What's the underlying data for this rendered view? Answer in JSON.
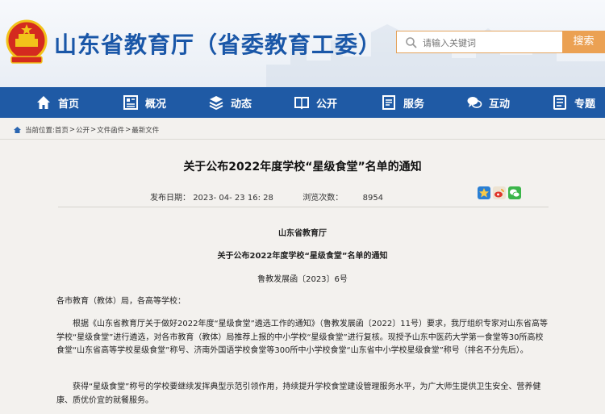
{
  "header": {
    "site_title": "山东省教育厅（省委教育工委）",
    "search_placeholder": "请输入关键词",
    "search_button": "搜索"
  },
  "nav": [
    {
      "label": "首页",
      "icon": "home-icon"
    },
    {
      "label": "概况",
      "icon": "overview-icon"
    },
    {
      "label": "动态",
      "icon": "news-icon"
    },
    {
      "label": "公开",
      "icon": "book-icon"
    },
    {
      "label": "服务",
      "icon": "service-icon"
    },
    {
      "label": "互动",
      "icon": "chat-icon"
    },
    {
      "label": "专题",
      "icon": "topic-icon"
    }
  ],
  "breadcrumb": {
    "prefix": "当前位置:",
    "items": [
      "首页",
      "公开",
      "文件函件",
      "最新文件"
    ],
    "separator": ">"
  },
  "article": {
    "title": "关于公布2022年度学校“星级食堂”名单的通知",
    "publish_label": "发布日期：",
    "publish_date": "2023- 04- 23 16: 28",
    "views_label": "浏览次数：",
    "views": "8954",
    "issuer": "山东省教育厅",
    "doc_title": "关于公布2022年度学校“星级食堂”名单的通知",
    "doc_number": "鲁教发展函〔2023〕6号",
    "salutation": "各市教育（教体）局，各高等学校：",
    "para1": "根据《山东省教育厅关于做好2022年度“星级食堂”遴选工作的通知》（鲁教发展函〔2022〕11号）要求，我厅组织专家对山东省高等学校“星级食堂”进行遴选，对各市教育（教体）局推荐上报的中小学校“星级食堂”进行复核。现授予山东中医药大学第一食堂等30所高校食堂“山东省高等学校星级食堂”称号、济南外国语学校食堂等300所中小学校食堂“山东省中小学校星级食堂”称号（排名不分先后）。",
    "para2": "获得“星级食堂”称号的学校要继续发挥典型示范引领作用，持续提升学校食堂建设管理服务水平，为广大师生提供卫生安全、营养健康、质优价宜的就餐服务。"
  },
  "share": [
    {
      "name": "qzone-share-icon",
      "color": "#2a7fd4"
    },
    {
      "name": "weibo-share-icon",
      "color": "#e8d3b0"
    },
    {
      "name": "wechat-share-icon",
      "color": "#3bb54a"
    }
  ],
  "colors": {
    "brand_blue": "#1f5aa5",
    "title_blue": "#1a57a8",
    "search_orange": "#eba153",
    "emblem_red": "#d42a1f",
    "emblem_gold": "#f2c21a"
  }
}
